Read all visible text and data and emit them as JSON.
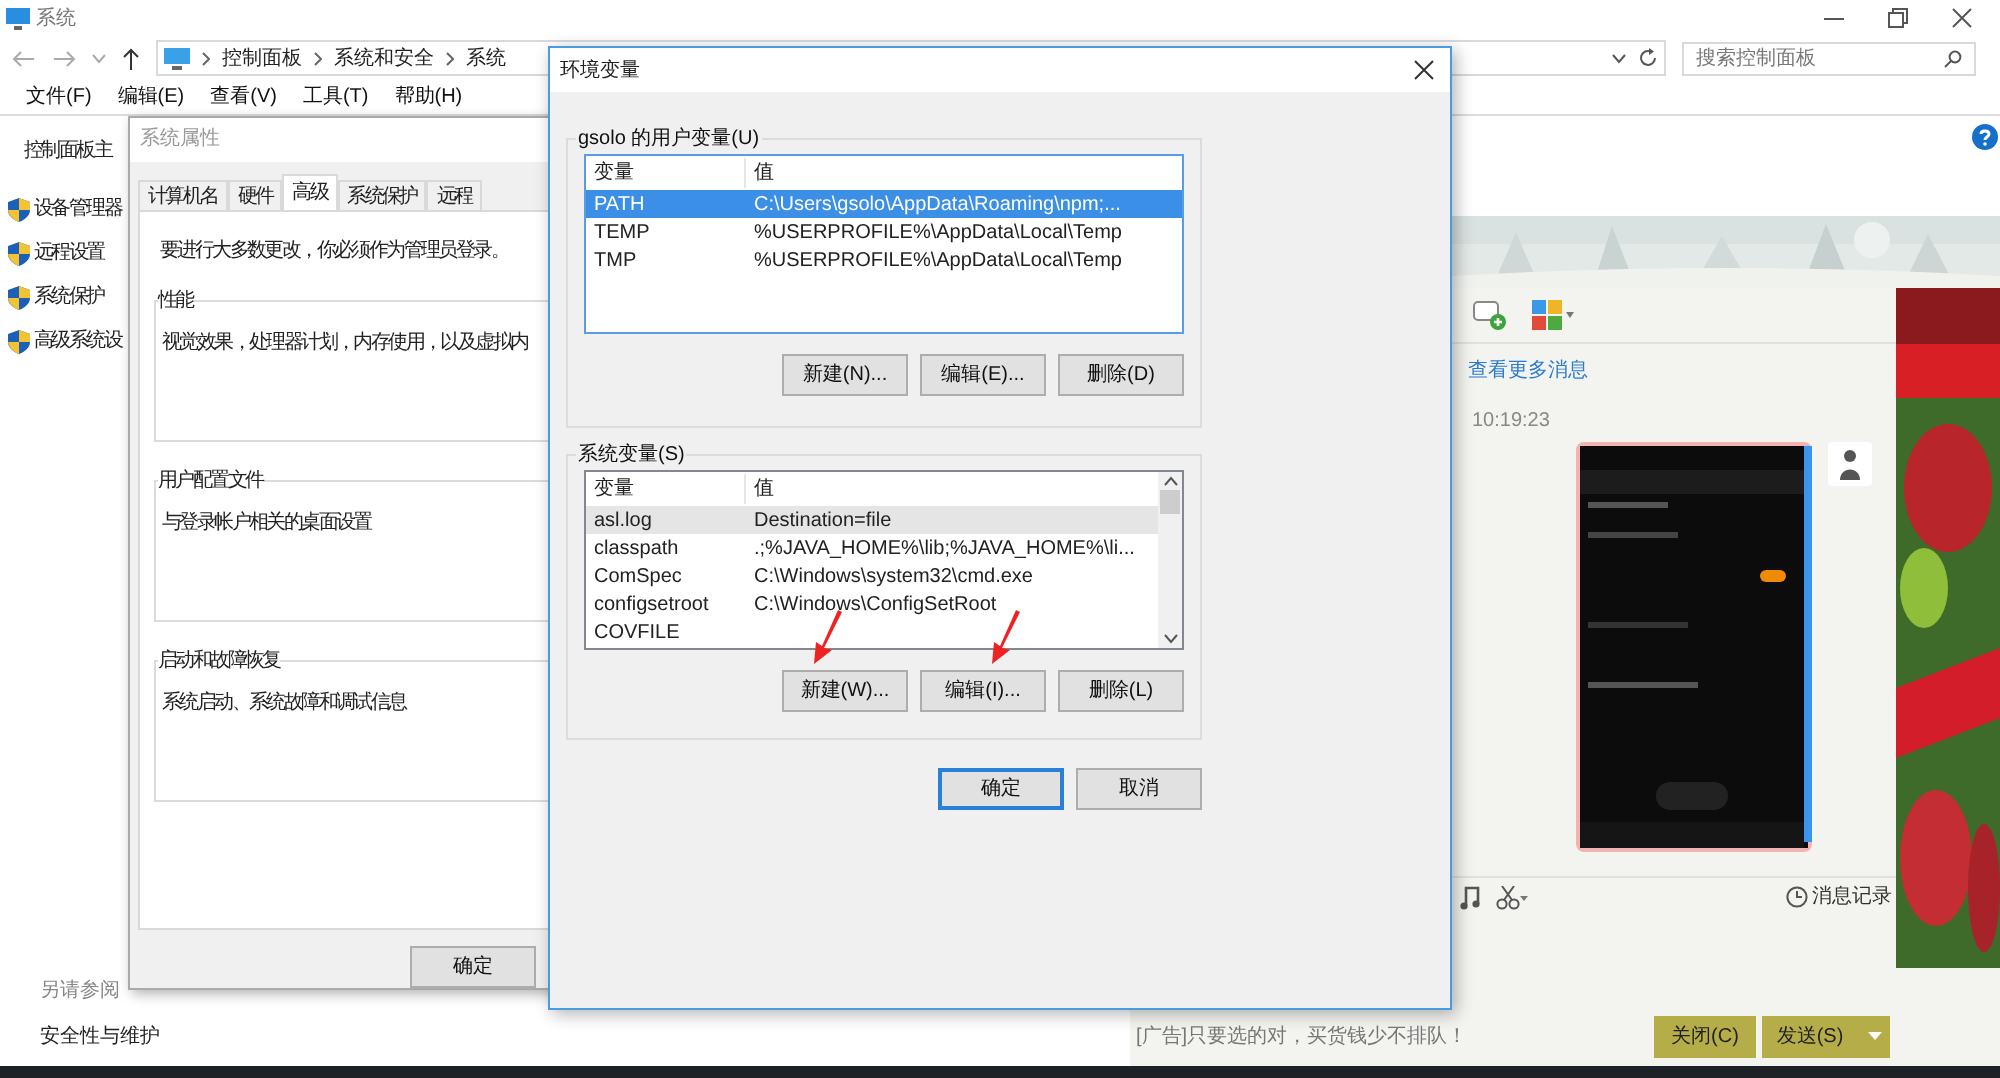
{
  "control_panel": {
    "title": "系统",
    "breadcrumb": [
      "控制面板",
      "系统和安全",
      "系统"
    ],
    "search": {
      "placeholder": "搜索控制面板"
    },
    "menu": [
      "文件(F)",
      "编辑(E)",
      "查看(V)",
      "工具(T)",
      "帮助(H)"
    ],
    "sidebar": {
      "home": "控制面板主",
      "links": [
        "设备管理器",
        "远程设置",
        "系统保护",
        "高级系统设"
      ],
      "see_also": "另请参阅",
      "see_also_links": [
        "安全性与维护"
      ]
    }
  },
  "system_properties": {
    "title": "系统属性",
    "tabs": [
      {
        "label": "计算机名",
        "selected": false
      },
      {
        "label": "硬件",
        "selected": false
      },
      {
        "label": "高级",
        "selected": true
      },
      {
        "label": "系统保护",
        "selected": false
      },
      {
        "label": "远程",
        "selected": false
      }
    ],
    "notice": "要进行大多数更改，你必须作为管理员登录。",
    "groups": [
      {
        "title": "性能",
        "text": "视觉效果，处理器计划，内存使用，以及虚拟内"
      },
      {
        "title": "用户配置文件",
        "text": "与登录帐户相关的桌面设置"
      },
      {
        "title": "启动和故障恢复",
        "text": "系统启动、系统故障和调试信息"
      }
    ],
    "buttons": [
      "确定"
    ]
  },
  "env_dialog": {
    "title": "环境变量",
    "user_vars": {
      "title": "gsolo 的用户变量(U)",
      "focused": true,
      "columns": [
        "变量",
        "值"
      ],
      "rows": [
        {
          "name": "PATH",
          "value": "C:\\Users\\gsolo\\AppData\\Roaming\\npm;...",
          "selected": true
        },
        {
          "name": "TEMP",
          "value": "%USERPROFILE%\\AppData\\Local\\Temp",
          "selected": false
        },
        {
          "name": "TMP",
          "value": "%USERPROFILE%\\AppData\\Local\\Temp",
          "selected": false
        }
      ],
      "buttons": [
        "新建(N)...",
        "编辑(E)...",
        "删除(D)"
      ]
    },
    "system_vars": {
      "title": "系统变量(S)",
      "focused": false,
      "columns": [
        "变量",
        "值"
      ],
      "rows": [
        {
          "name": "asl.log",
          "value": "Destination=file",
          "selected": true
        },
        {
          "name": "classpath",
          "value": ".;%JAVA_HOME%\\lib;%JAVA_HOME%\\li...",
          "selected": false
        },
        {
          "name": "ComSpec",
          "value": "C:\\Windows\\system32\\cmd.exe",
          "selected": false
        },
        {
          "name": "configsetroot",
          "value": "C:\\Windows\\ConfigSetRoot",
          "selected": false
        },
        {
          "name": "COVFILE",
          "value": "",
          "selected": false
        }
      ],
      "buttons": [
        "新建(W)...",
        "编辑(I)...",
        "删除(L)"
      ]
    },
    "buttons": [
      {
        "label": "确定",
        "default": true
      },
      {
        "label": "取消",
        "default": false
      }
    ]
  },
  "chat": {
    "more_link": "查看更多消息",
    "time": "10:19:23",
    "history": "消息记录",
    "ad_text": "[广告]只要选的对，买货钱少不排队！",
    "buttons": [
      "关闭(C)",
      "发送(S)"
    ]
  }
}
